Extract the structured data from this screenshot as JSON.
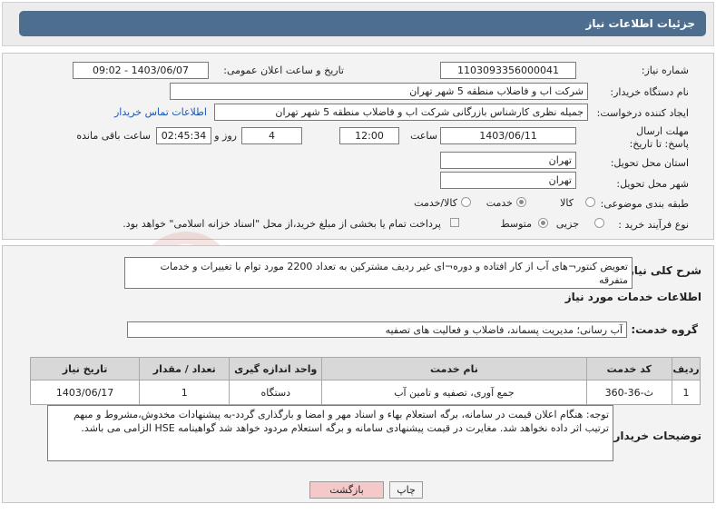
{
  "header": {
    "title": "جزئیات اطلاعات نیاز"
  },
  "form": {
    "need_number_label": "شماره نیاز:",
    "need_number": "1103093356000041",
    "announce_label": "تاریخ و ساعت اعلان عمومی:",
    "announce_value": "1403/06/07 - 09:02",
    "buyer_org_label": "نام دستگاه خریدار:",
    "buyer_org": "شرکت اب و فاضلاب منطقه 5 شهر تهران",
    "creator_label": "ایجاد کننده درخواست:",
    "creator": "جمیله نظری کارشناس بازرگانی شرکت اب و فاضلاب منطقه 5 شهر تهران",
    "contact_link": "اطلاعات تماس خریدار",
    "deadline_label": "مهلت ارسال پاسخ: تا تاریخ:",
    "deadline_date": "1403/06/11",
    "time_label": "ساعت",
    "deadline_time": "12:00",
    "days_value": "4",
    "days_label": "روز و",
    "remaining_time": "02:45:34",
    "remaining_label": "ساعت باقی مانده",
    "province_label": "استان محل تحویل:",
    "province": "تهران",
    "city_label": "شهر محل تحویل:",
    "city": "تهران",
    "category_label": "طبقه بندی موضوعی:",
    "category_options": [
      "کالا",
      "خدمت",
      "کالا/خدمت"
    ],
    "category_selected": "خدمت",
    "process_label": "نوع فرآیند خرید :",
    "process_options": [
      "جزیی",
      "متوسط"
    ],
    "process_selected": "متوسط",
    "payment_note": "پرداخت تمام یا بخشی از مبلغ خرید،از محل \"اسناد خزانه اسلامی\" خواهد بود."
  },
  "summary": {
    "label": "شرح کلی نیاز:",
    "text": "تعویض کنتور¬های آب از کار افتاده و دوره¬ای غیر ردیف مشترکین به تعداد 2200 مورد توام با تغییرات و خدمات متفرقه"
  },
  "services": {
    "section_title": "اطلاعات خدمات مورد نیاز",
    "group_label": "گروه خدمت:",
    "group_value": "آب رسانی؛ مدیریت پسماند، فاضلاب و فعالیت های تصفیه",
    "columns": [
      "ردیف",
      "کد خدمت",
      "نام خدمت",
      "واحد اندازه گیری",
      "تعداد / مقدار",
      "تاریخ نیاز"
    ],
    "rows": [
      [
        "1",
        "ث-36-360",
        "جمع آوری، تصفیه و تامین آب",
        "دستگاه",
        "1",
        "1403/06/17"
      ]
    ]
  },
  "buyer_notes": {
    "label": "توضیحات خریدار:",
    "text": "توجه: هنگام اعلان قیمت در سامانه، برگه استعلام بهاء و اسناد مهر و امضا و بارگذاری گردد-به پیشنهادات مخدوش،مشروط و مبهم ترتیب اثر داده نخواهد شد. مغایرت در قیمت پیشنهادی سامانه و برگه استعلام مردود خواهد شد گواهینامه HSE الزامی می باشد."
  },
  "buttons": {
    "print": "چاپ",
    "back": "بازگشت"
  },
  "watermark_text": "AriaTender.neT",
  "colors": {
    "header_bg": "#4e6e90",
    "link": "#1a56b5",
    "watermark": "#c0392b"
  }
}
